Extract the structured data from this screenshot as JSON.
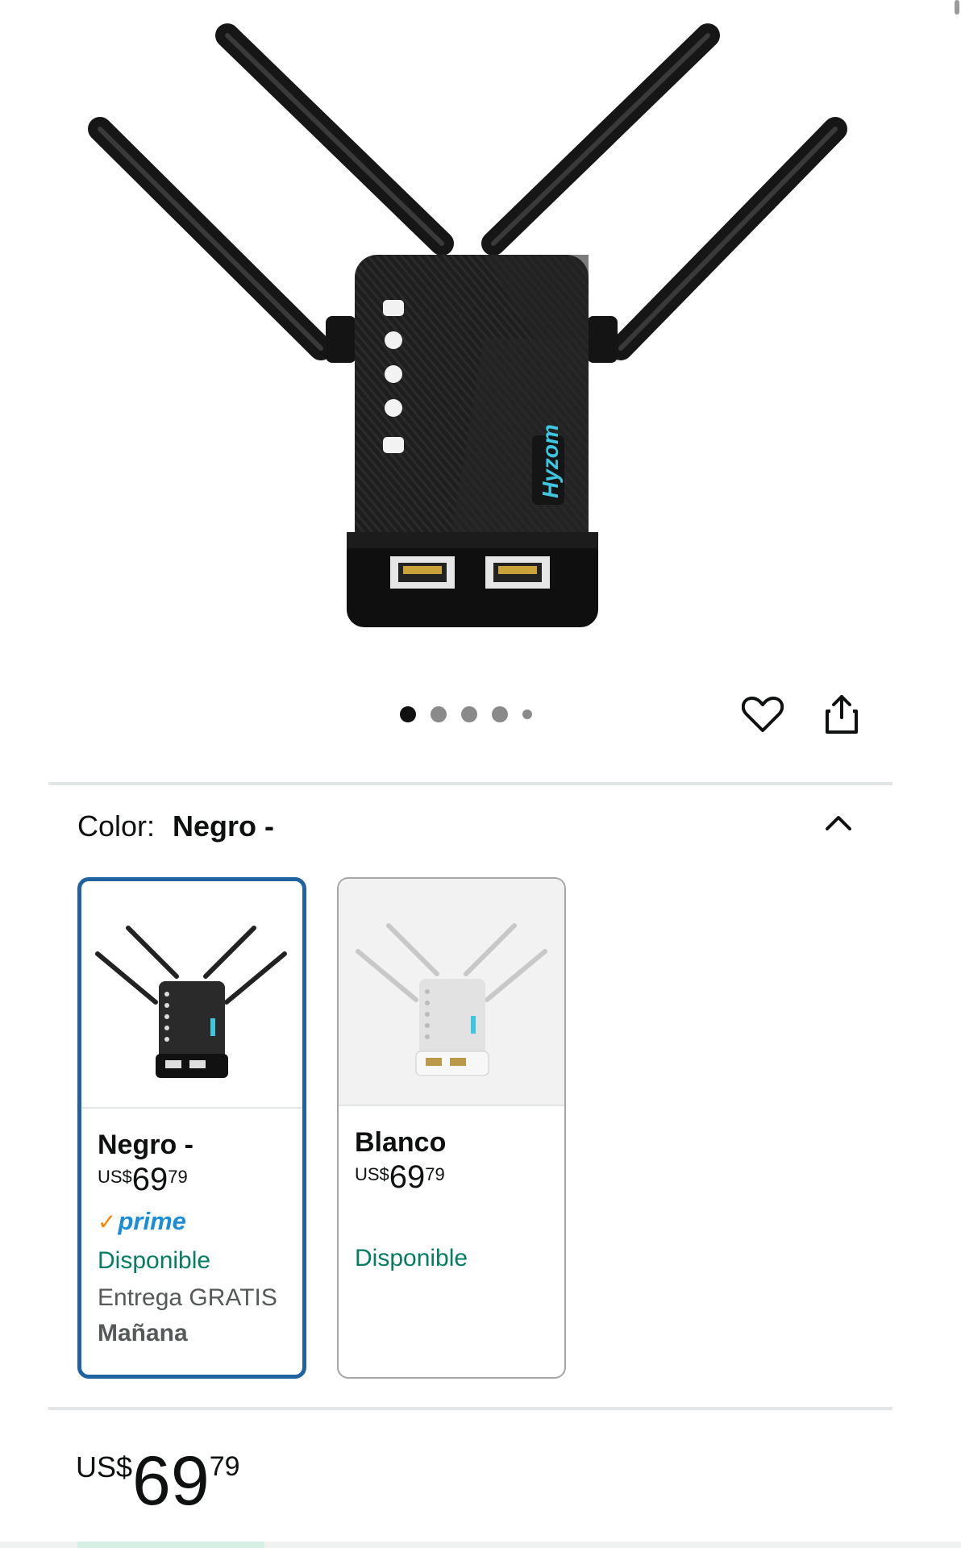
{
  "gallery": {
    "brand_logo_text": "Hyzom",
    "image_count": 5,
    "active_index": 0
  },
  "icons": {
    "favorite": "heart-icon",
    "share": "share-icon",
    "collapse": "chevron-up-icon"
  },
  "color_selector": {
    "label": "Color:",
    "selected_value": "Negro -",
    "options": [
      {
        "name": "Negro -",
        "currency": "US$",
        "price_whole": "69",
        "price_fraction": "79",
        "prime_check": "✓",
        "prime_label": "prime",
        "availability": "Disponible",
        "delivery": "Entrega GRATIS",
        "delivery_day": "Mañana",
        "selected": true
      },
      {
        "name": "Blanco",
        "currency": "US$",
        "price_whole": "69",
        "price_fraction": "79",
        "availability": "Disponible",
        "selected": false
      }
    ]
  },
  "price": {
    "currency": "US$",
    "whole": "69",
    "fraction": "79"
  },
  "colors": {
    "selected_border": "#2162a1",
    "availability_green": "#067d62",
    "prime_blue": "#1a8cd8",
    "prime_check_orange": "#f08804"
  }
}
